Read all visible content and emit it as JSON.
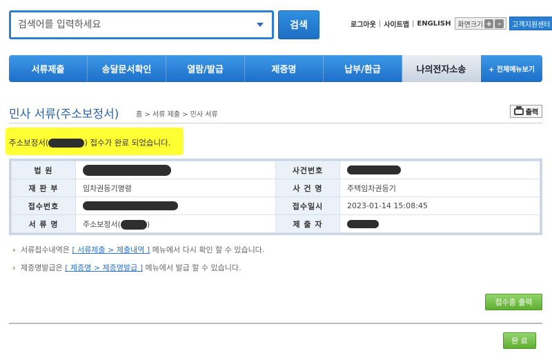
{
  "search": {
    "placeholder": "검색어를 입력하세요",
    "button": "검색"
  },
  "util": {
    "logout": "로그아웃",
    "sitemap": "사이트맵",
    "english": "ENGLISH",
    "zoom_label": "화면크기",
    "zoom_in": "+",
    "zoom_out": "-",
    "support": "고객지원센터"
  },
  "nav": {
    "items": [
      "서류제출",
      "송달문서확인",
      "열람/발급",
      "제증명",
      "납부/환급",
      "나의전자소송"
    ],
    "active_index": 5,
    "all_menu": "+ 전체메뉴보기"
  },
  "page": {
    "title": "민사 서류(주소보정서)",
    "breadcrumb": "홈 > 서류 제출 > 민사 서류",
    "print": "출력"
  },
  "notice": {
    "prefix": "주소보정서(",
    "suffix": ") 접수가 완료 되었습니다."
  },
  "info": {
    "court_label": "법 원",
    "case_no_label": "사건번호",
    "division_label": "재 판 부",
    "division_value": "임차권등기명령",
    "case_name_label": "사 건 명",
    "case_name_value": "주택임차권등기",
    "receipt_no_label": "접수번호",
    "receipt_time_label": "접수일시",
    "receipt_time_value": "2023-01-14 15:08:45",
    "doc_name_label": "서 류 명",
    "doc_name_prefix": "주소보정서(",
    "doc_name_suffix": ")",
    "submitter_label": "제 출 자"
  },
  "guide": {
    "line1_prefix": "서류접수내역은",
    "line1_link": "[ 서류제출 > 제출내역 ]",
    "line1_suffix": "메뉴에서 다시 확인 할 수 있습니다.",
    "line2_prefix": "제증명발급은",
    "line2_link": "[ 제증명 > 제증명발급 ]",
    "line2_suffix": "메뉴에서 발급 할 수 있습니다."
  },
  "buttons": {
    "receipt_print": "접수증 출력",
    "done": "완 료"
  }
}
